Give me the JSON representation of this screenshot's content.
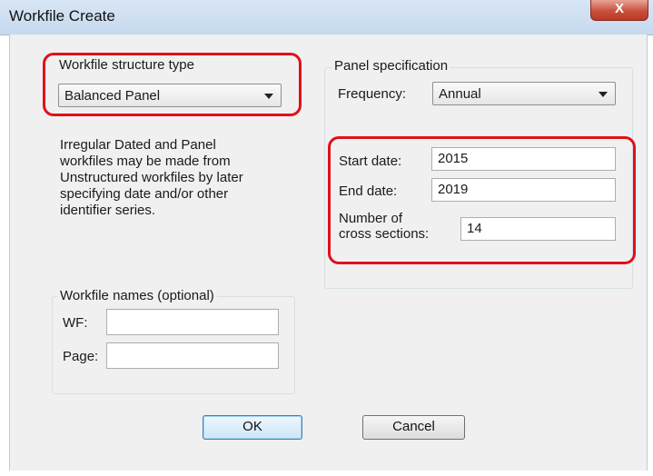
{
  "window": {
    "title": "Workfile Create",
    "close_glyph": "X"
  },
  "structure": {
    "group_label": "Workfile structure type",
    "selected": "Balanced Panel",
    "description_lines": [
      "Irregular Dated and Panel",
      "workfiles may be made from",
      "Unstructured workfiles by later",
      "specifying date and/or other",
      "identifier series."
    ]
  },
  "panel_spec": {
    "group_label": "Panel specification",
    "frequency_label": "Frequency:",
    "frequency_value": "Annual",
    "start_label": "Start date:",
    "start_value": "2015",
    "end_label": "End date:",
    "end_value": "2019",
    "cross_label_line1": "Number of",
    "cross_label_line2": "cross sections:",
    "cross_value": "14"
  },
  "names": {
    "group_label": "Workfile names (optional)",
    "wf_label": "WF:",
    "wf_value": "",
    "page_label": "Page:",
    "page_value": ""
  },
  "buttons": {
    "ok": "OK",
    "cancel": "Cancel"
  },
  "colors": {
    "highlight": "#e0101a",
    "dialog_bg": "#f0f0f0",
    "titlebar": "#c6d9ee"
  }
}
